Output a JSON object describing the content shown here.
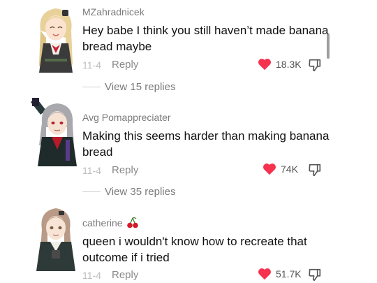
{
  "comments": [
    {
      "username": "MZahradnicek",
      "text": "Hey babe I think you still haven’t made banana bread maybe",
      "date": "11-4",
      "reply_label": "Reply",
      "likes": "18.3K",
      "view_replies": "View 15 replies"
    },
    {
      "username": "Avg Pomappreciater",
      "text": "Making this seems harder than making banana bread",
      "date": "11-4",
      "reply_label": "Reply",
      "likes": "74K",
      "view_replies": "View 35 replies"
    },
    {
      "username": "catherine",
      "username_emoji": "🍒",
      "text": "queen i wouldn't know how to recreate that outcome if i tried",
      "date": "11-4",
      "reply_label": "Reply",
      "likes": "51.7K"
    }
  ],
  "colors": {
    "heart": "#f5334f",
    "username": "#7b7b7b",
    "date": "#bdbdbd"
  },
  "icons": [
    "heart-icon",
    "dislike-icon",
    "cherry-icon"
  ]
}
